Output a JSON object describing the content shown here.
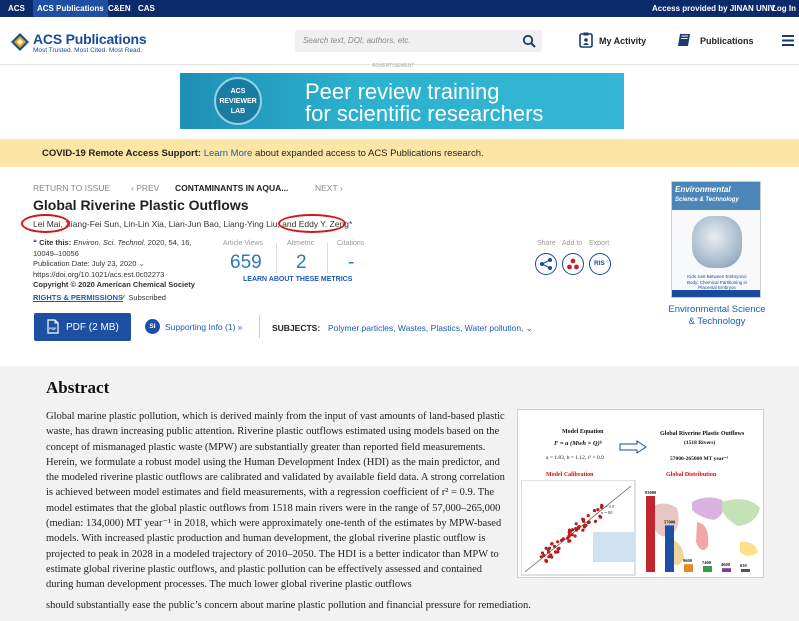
{
  "topbar": {
    "links": [
      "ACS",
      "ACS Publications",
      "C&EN",
      "CAS"
    ],
    "access": "Access provided by JINAN UNIV",
    "login": "Log In"
  },
  "header": {
    "brand": "ACS Publications",
    "tagline": "Most Trusted. Most Cited. Most Read.",
    "search_placeholder": "Search text, DOI, authors, etc.",
    "my_activity": "My Activity",
    "publications": "Publications"
  },
  "ad": {
    "label": "ADVERTISEMENT",
    "badge_top": "ACS",
    "badge_mid": "REVIEWER",
    "badge_bottom": "LAB",
    "line1": "Peer review training",
    "line2": "for scientific researchers"
  },
  "covid": {
    "bold": "COVID-19 Remote Access Support:",
    "link": "Learn More",
    "rest": "about expanded access to ACS Publications research."
  },
  "article_nav": {
    "return": "RETURN TO ISSUE",
    "prev": "‹ PREV",
    "section": "CONTAMINANTS IN AQUA...",
    "next": "NEXT ›"
  },
  "article": {
    "title": "Global Riverine Plastic Outflows",
    "authors": "Lei Mai, Xiang-Fei Sun, Lin-Lin Xia, Lian-Jun Bao, Liang-Ying Liu, and Eddy Y. Zeng*",
    "cite_label": "Cite this:",
    "cite_journal": "Environ. Sci. Technol.",
    "cite_detail": "2020, 54, 16, 10049–10056",
    "pub_date": "Publication Date: July 23, 2020",
    "doi": "https://doi.org/10.1021/acs.est.0c02273",
    "copyright": "Copyright © 2020 American Chemical Society",
    "rights": "RIGHTS & PERMISSIONS",
    "subscribed": "Subscribed"
  },
  "metrics": {
    "views_label": "Article Views",
    "views": "659",
    "altmetric_label": "Altmetric",
    "altmetric": "2",
    "citations_label": "Citations",
    "citations": "-",
    "learn": "LEARN ABOUT THESE METRICS"
  },
  "actions": {
    "share": "Share",
    "add_to": "Add to",
    "export": "Export",
    "ris": "RIS"
  },
  "journal_cover": {
    "title_line1": "Environmental",
    "title_line2": "Science & Technology",
    "caption": "Kids Just Between Embryonic Body: Chemical Partitioning in Placental Embryos",
    "name": "Environmental Science & Technology"
  },
  "buttons": {
    "pdf": "PDF (2 MB)",
    "si_badge": "SI",
    "supporting": "Supporting Info (1) »",
    "subjects_label": "SUBJECTS:",
    "subjects": "Polymer particles,  Wastes,  Plastics,  Water pollution,  ⌄"
  },
  "abstract": {
    "heading": "Abstract",
    "body": "Global marine plastic pollution, which is derived mainly from the input of vast amounts of land-based plastic waste, has drawn increasing public attention. Riverine plastic outflows estimated using models based on the concept of mismanaged plastic waste (MPW) are substantially greater than reported field measurements. Herein, we formulate a robust model using the Human Development Index (HDI) as the main predictor, and the modeled riverine plastic outflows are calibrated and validated by available field data. A strong correlation is achieved between model estimates and field measurements, with a regression coefficient of r² = 0.9. The model estimates that the global plastic outflows from 1518 main rivers were in the range of 57,000–265,000 (median: 134,000) MT year⁻¹ in 2018, which were approximately one-tenth of the estimates by MPW-based models. With increased plastic production and human development, the global riverine plastic outflow is projected to peak in 2028 in a modeled trajectory of 2010–2050. The HDI is a better indicator than MPW to estimate global riverine plastic outflows, and plastic pollution can be effectively assessed and contained during human development processes. The much lower global riverine plastic outflows",
    "last_line": "should substantially ease the public’s concern about marine plastic pollution and financial pressure for remediation."
  },
  "toc_graphic": {
    "model_equation": "Model Equation",
    "equation": "F = a (Mwh × Q)ᵇ",
    "params": "a = 1.83, b = 1.12, r² = 0.9",
    "right_title": "Global Riverine Plastic Outflows",
    "rivers": "(1518 Rivers)",
    "range": "57000-265000 MT year⁻¹",
    "calibration": "Model Calibration",
    "distribution": "Global Distribution",
    "bars": [
      93000,
      57000,
      9600,
      7400,
      4600,
      630
    ],
    "fit_text": "r² = 0.9",
    "n_text": "n = 80"
  }
}
